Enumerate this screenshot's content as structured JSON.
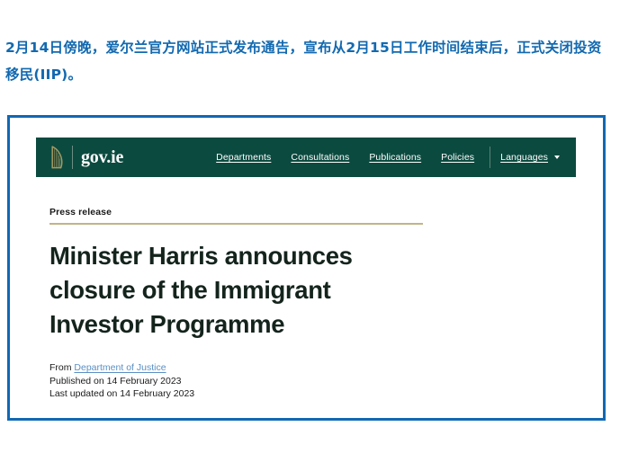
{
  "caption": {
    "text": "2月14日傍晚，爱尔兰官方网站正式发布通告，宣布从2月15日工作时间结束后，正式关闭投资移民(IIP)。",
    "color": "#1269b0"
  },
  "frame": {
    "border_color": "#1168b3"
  },
  "gov_header": {
    "background": "#0b4a3f",
    "harp_icon": "harp-icon",
    "wordmark": "gov.ie",
    "nav": [
      {
        "label": "Departments"
      },
      {
        "label": "Consultations"
      },
      {
        "label": "Publications"
      },
      {
        "label": "Policies"
      }
    ],
    "languages": {
      "label": "Languages",
      "caret_icon": "chevron-down-icon"
    }
  },
  "article": {
    "kicker": "Press release",
    "rule_color": "#c2b489",
    "headline": "Minister Harris announces closure of the Immigrant Investor Programme",
    "meta": {
      "from_prefix": "From ",
      "from_department": "Department of Justice",
      "published": "Published on 14 February 2023",
      "last_updated": "Last updated on 14 February 2023",
      "link_color": "#5a8fc4"
    }
  }
}
